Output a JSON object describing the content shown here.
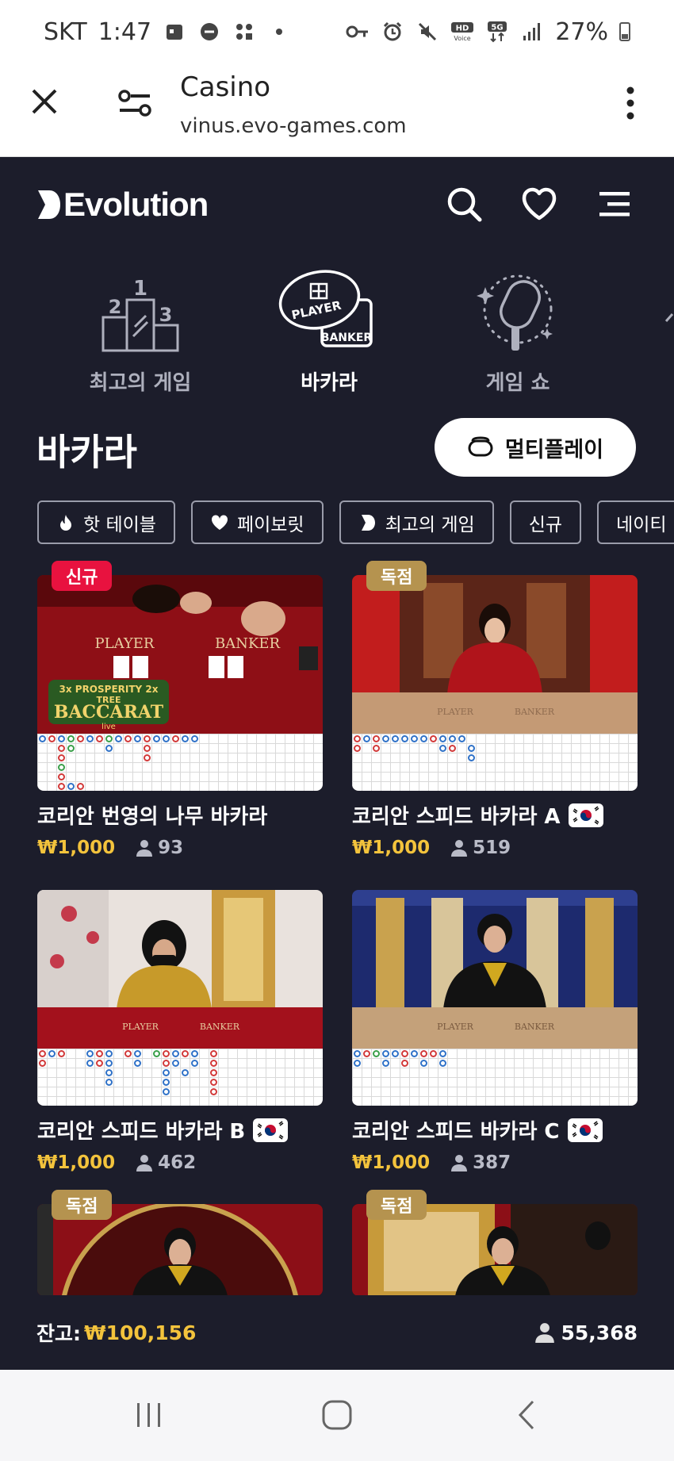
{
  "status_bar": {
    "carrier": "SKT",
    "time": "1:47",
    "battery": "27%",
    "icons_left": [
      "calendar-icon",
      "dnd-icon",
      "apps-icon",
      "dot-icon"
    ],
    "icons_right": [
      "vpn-key-icon",
      "alarm-icon",
      "mute-icon",
      "hd-voice-icon",
      "5g-icon",
      "signal-icon",
      "battery-icon"
    ]
  },
  "browser": {
    "title": "Casino",
    "url": "vinus.evo-games.com"
  },
  "header": {
    "brand": "Evolution"
  },
  "categories": [
    {
      "label": "최고의 게임",
      "icon": "podium-icon",
      "active": false
    },
    {
      "label": "바카라",
      "icon": "baccarat-icon",
      "active": true
    },
    {
      "label": "게임 쇼",
      "icon": "microphone-icon",
      "active": false
    }
  ],
  "baccarat_icon_text": {
    "player": "PLAYER",
    "banker": "BANKER"
  },
  "page_title": "바카라",
  "multiplay_label": "멀티플레이",
  "chips": [
    {
      "label": "핫 테이블",
      "icon": "flame-icon"
    },
    {
      "label": "페이보릿",
      "icon": "heart-icon"
    },
    {
      "label": "최고의 게임",
      "icon": "evolution-icon"
    },
    {
      "label": "신규",
      "icon": ""
    },
    {
      "label": "네이티",
      "icon": ""
    }
  ],
  "tables": [
    {
      "name": "코리안 번영의 나무 바카라",
      "price": "₩1,000",
      "players": "93",
      "badge": "신규",
      "flag": false,
      "scene_player": "PLAYER",
      "scene_banker": "BANKER",
      "logo_top": "3x PROSPERITY 2x",
      "logo_sub": "TREE",
      "logo_main": "BACCARAT",
      "logo_live": "live"
    },
    {
      "name": "코리안 스피드 바카라 A",
      "price": "₩1,000",
      "players": "519",
      "badge": "독점",
      "flag": true,
      "scene_player": "PLAYER",
      "scene_banker": "BANKER"
    },
    {
      "name": "코리안 스피드 바카라 B",
      "price": "₩1,000",
      "players": "462",
      "badge": "",
      "flag": true,
      "scene_player": "PLAYER",
      "scene_banker": "BANKER"
    },
    {
      "name": "코리안 스피드 바카라 C",
      "price": "₩1,000",
      "players": "387",
      "badge": "",
      "flag": true,
      "scene_player": "PLAYER",
      "scene_banker": "BANKER"
    },
    {
      "badge": "독점"
    },
    {
      "badge": "독점"
    }
  ],
  "footer": {
    "balance_label": "잔고:",
    "balance_value": "₩100,156",
    "online_count": "55,368"
  },
  "colors": {
    "background": "#1c1d2b",
    "accent_gold": "#f3c33c",
    "badge_new": "#e8123f",
    "badge_exclusive": "#b5934f"
  }
}
